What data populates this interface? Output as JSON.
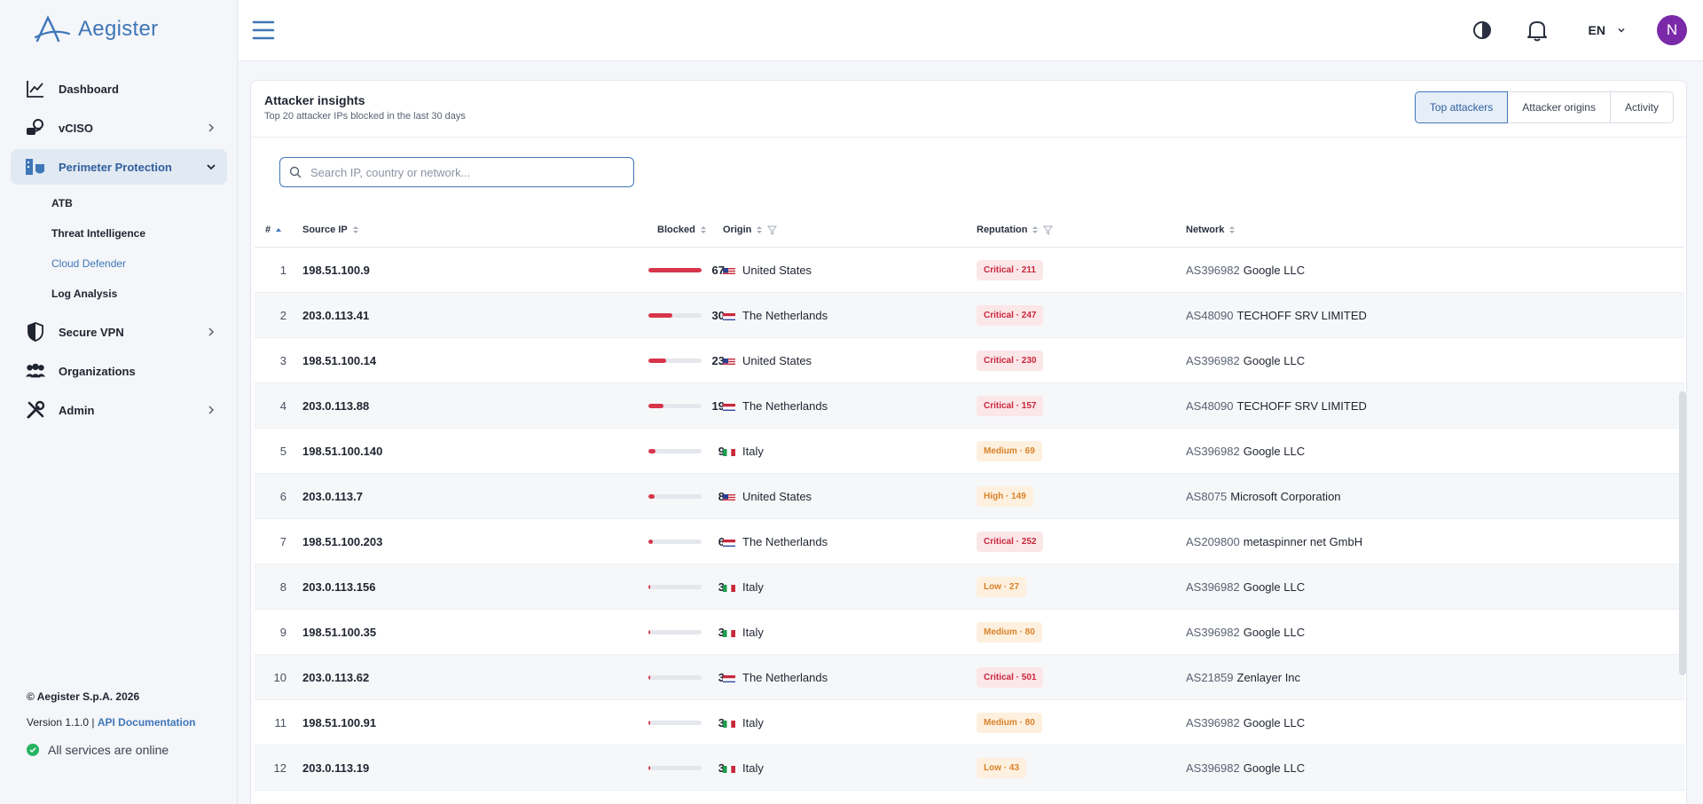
{
  "brand": {
    "name": "Aegister"
  },
  "sidebar": {
    "items": [
      {
        "label": "Dashboard",
        "icon": "chart-line-icon"
      },
      {
        "label": "vCISO",
        "icon": "vciso-icon"
      },
      {
        "label": "Perimeter Protection",
        "icon": "perimeter-icon"
      },
      {
        "label": "Secure VPN",
        "icon": "shield-icon"
      },
      {
        "label": "Organizations",
        "icon": "people-icon"
      },
      {
        "label": "Admin",
        "icon": "tools-icon"
      }
    ],
    "perimeter_sub": [
      "ATB",
      "Threat Intelligence",
      "Cloud Defender",
      "Log Analysis"
    ],
    "active_sub": "Cloud Defender"
  },
  "footer": {
    "copyright": "© Aegister S.p.A. 2026",
    "version": "Version 1.1.0 |",
    "api_link": "API Documentation",
    "status": "All services are online"
  },
  "topbar": {
    "language": "EN",
    "avatar_initial": "N"
  },
  "insights": {
    "title": "Attacker insights",
    "subtitle": "Top 20 attacker IPs blocked in the last 30 days",
    "tabs": [
      "Top attackers",
      "Attacker origins",
      "Activity"
    ],
    "active_tab": "Top attackers",
    "search_placeholder": "Search IP, country or network..."
  },
  "table": {
    "columns": {
      "index": "#",
      "source_ip": "Source IP",
      "blocked": "Blocked",
      "origin": "Origin",
      "reputation": "Reputation",
      "network": "Network"
    },
    "max_blocked": 67,
    "rows": [
      {
        "idx": "1",
        "ip": "198.51.100.9",
        "blocked": 67,
        "country": "United States",
        "flag": "us",
        "rep": "Critical · 211",
        "level": "critical",
        "asn": "AS396982",
        "org": "Google LLC"
      },
      {
        "idx": "2",
        "ip": "203.0.113.41",
        "blocked": 30,
        "country": "The Netherlands",
        "flag": "nl",
        "rep": "Critical · 247",
        "level": "critical",
        "asn": "AS48090",
        "org": "TECHOFF SRV LIMITED"
      },
      {
        "idx": "3",
        "ip": "198.51.100.14",
        "blocked": 23,
        "country": "United States",
        "flag": "us",
        "rep": "Critical · 230",
        "level": "critical",
        "asn": "AS396982",
        "org": "Google LLC"
      },
      {
        "idx": "4",
        "ip": "203.0.113.88",
        "blocked": 19,
        "country": "The Netherlands",
        "flag": "nl",
        "rep": "Critical · 157",
        "level": "critical",
        "asn": "AS48090",
        "org": "TECHOFF SRV LIMITED"
      },
      {
        "idx": "5",
        "ip": "198.51.100.140",
        "blocked": 9,
        "country": "Italy",
        "flag": "it",
        "rep": "Medium · 69",
        "level": "medium",
        "asn": "AS396982",
        "org": "Google LLC"
      },
      {
        "idx": "6",
        "ip": "203.0.113.7",
        "blocked": 8,
        "country": "United States",
        "flag": "us",
        "rep": "High · 149",
        "level": "high",
        "asn": "AS8075",
        "org": "Microsoft Corporation"
      },
      {
        "idx": "7",
        "ip": "198.51.100.203",
        "blocked": 6,
        "country": "The Netherlands",
        "flag": "nl",
        "rep": "Critical · 252",
        "level": "critical",
        "asn": "AS209800",
        "org": "metaspinner net GmbH"
      },
      {
        "idx": "8",
        "ip": "203.0.113.156",
        "blocked": 3,
        "country": "Italy",
        "flag": "it",
        "rep": "Low · 27",
        "level": "low",
        "asn": "AS396982",
        "org": "Google LLC"
      },
      {
        "idx": "9",
        "ip": "198.51.100.35",
        "blocked": 3,
        "country": "Italy",
        "flag": "it",
        "rep": "Medium · 80",
        "level": "medium",
        "asn": "AS396982",
        "org": "Google LLC"
      },
      {
        "idx": "10",
        "ip": "203.0.113.62",
        "blocked": 3,
        "country": "The Netherlands",
        "flag": "nl",
        "rep": "Critical · 501",
        "level": "critical",
        "asn": "AS21859",
        "org": "Zenlayer Inc"
      },
      {
        "idx": "11",
        "ip": "198.51.100.91",
        "blocked": 3,
        "country": "Italy",
        "flag": "it",
        "rep": "Medium · 80",
        "level": "medium",
        "asn": "AS396982",
        "org": "Google LLC"
      },
      {
        "idx": "12",
        "ip": "203.0.113.19",
        "blocked": 3,
        "country": "Italy",
        "flag": "it",
        "rep": "Low · 43",
        "level": "low",
        "asn": "AS396982",
        "org": "Google LLC"
      }
    ]
  },
  "colors": {
    "brand": "#3f76b8",
    "bar": "#d7354a",
    "critical_bg": "#fbe6e8",
    "critical_fg": "#c8283c",
    "warn_bg": "#fdf0de",
    "warn_fg": "#d9822b",
    "online": "#28b463",
    "avatar": "#7a2aa8"
  }
}
